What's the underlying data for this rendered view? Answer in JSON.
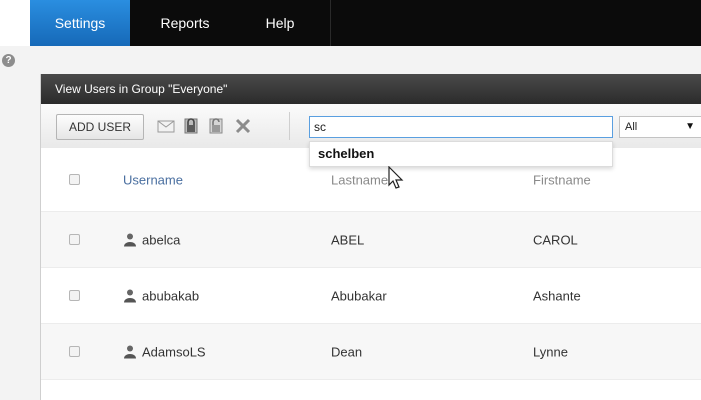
{
  "menu": {
    "tabs": [
      {
        "label": "Settings"
      },
      {
        "label": "Reports"
      },
      {
        "label": "Help"
      }
    ]
  },
  "help_icon": "?",
  "panel": {
    "title": "View Users in Group \"Everyone\""
  },
  "toolbar": {
    "add_user_label": "ADD USER",
    "icons": [
      "envelope-icon",
      "lock-icon",
      "unlock-icon",
      "delete-x-icon"
    ],
    "search_value": "sc",
    "filter_value": "All",
    "filter_arrow": "▼"
  },
  "autocomplete": {
    "items": [
      "schelben"
    ]
  },
  "table": {
    "columns": [
      "Username",
      "Lastname",
      "Firstname"
    ],
    "rows": [
      {
        "username": "abelca",
        "lastname": "ABEL",
        "firstname": "CAROL"
      },
      {
        "username": "abubakab",
        "lastname": "Abubakar",
        "firstname": "Ashante"
      },
      {
        "username": "AdamsoLS",
        "lastname": "Dean",
        "firstname": "Lynne"
      }
    ]
  },
  "colors": {
    "menu_active": "#1f7fd0",
    "menu_bg": "#0b0b0b",
    "header_link": "#4a6fa0",
    "search_border": "#5a9fe0"
  }
}
